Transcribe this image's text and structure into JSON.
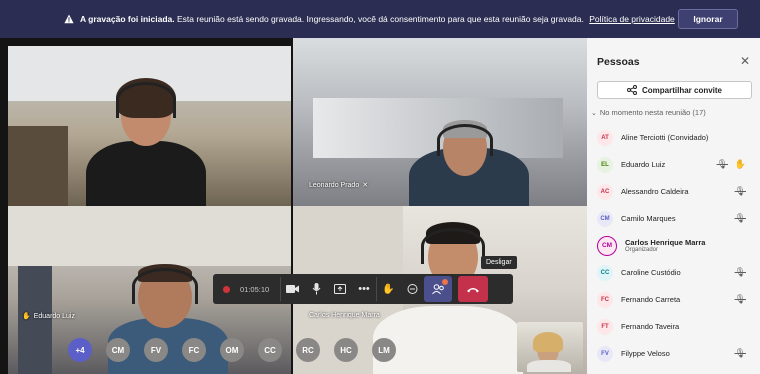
{
  "banner": {
    "bold": "A gravação foi iniciada.",
    "text": "Esta reunião está sendo gravada. Ingressando, você dá consentimento para que esta reunião seja gravada.",
    "link": "Política de privacidade",
    "ignore_label": "Ignorar"
  },
  "video": {
    "tiles": [
      {
        "name": ""
      },
      {
        "name": "Leonardo Prado"
      },
      {
        "name": "Eduardo Luiz"
      },
      {
        "name": "Carlos Henrique Marra"
      }
    ],
    "time": "01:05:10",
    "tooltip": "Desligar"
  },
  "avatar_strip": [
    {
      "label": "+4",
      "color": "#5b5fc7"
    },
    {
      "label": "CM",
      "color": "#8a8886"
    },
    {
      "label": "FV",
      "color": "#8a8886"
    },
    {
      "label": "FC",
      "color": "#8a8886"
    },
    {
      "label": "OM",
      "color": "#8a8886"
    },
    {
      "label": "CC",
      "color": "#8a8886"
    },
    {
      "label": "RC",
      "color": "#8a8886"
    },
    {
      "label": "HC",
      "color": "#8a8886"
    },
    {
      "label": "LM",
      "color": "#8a8886"
    }
  ],
  "panel": {
    "title": "Pessoas",
    "share_label": "Compartilhar convite",
    "section_label": "No momento nesta reunião (17)",
    "people": [
      {
        "initials": "AT",
        "name": "Aline Terciotti (Convidado)",
        "bg": "#fde7e9",
        "fg": "#c4314b"
      },
      {
        "initials": "EL",
        "name": "Eduardo Luiz",
        "bg": "#e7f2e3",
        "fg": "#498205"
      },
      {
        "initials": "AC",
        "name": "Alessandro Caldeira",
        "bg": "#fde7e9",
        "fg": "#c4314b"
      },
      {
        "initials": "CM",
        "name": "Camilo Marques",
        "bg": "#e8e8f7",
        "fg": "#5b5fc7"
      },
      {
        "initials": "CM",
        "name": "Carlos Henrique Marra",
        "role": "Organizador",
        "bg": "#fde7f1",
        "fg": "#b4009e"
      },
      {
        "initials": "CC",
        "name": "Caroline Custódio",
        "bg": "#e0f3f8",
        "fg": "#038387"
      },
      {
        "initials": "FC",
        "name": "Fernando Carreta",
        "bg": "#fde7e9",
        "fg": "#c4314b"
      },
      {
        "initials": "FT",
        "name": "Fernando Taveira",
        "bg": "#fde7e9",
        "fg": "#c4314b"
      },
      {
        "initials": "FV",
        "name": "Filyppe Veloso",
        "bg": "#e8e8f7",
        "fg": "#5b5fc7"
      }
    ]
  }
}
